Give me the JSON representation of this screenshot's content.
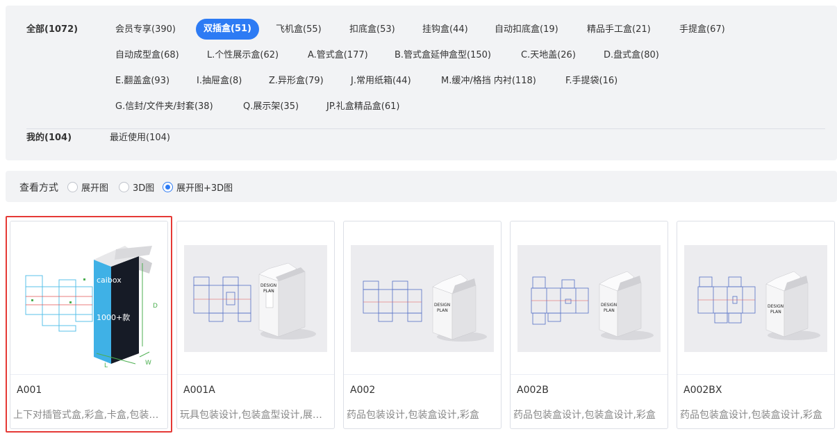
{
  "categories": {
    "all": "全部(1072)",
    "rows": [
      [
        "会员专享(390)",
        "双插盒(51)",
        "飞机盒(55)",
        "扣底盒(53)",
        "挂钩盒(44)",
        "自动扣底盒(19)",
        "精品手工盒(21)",
        "手提盒(67)"
      ],
      [
        "自动成型盒(68)",
        "L.个性展示盒(62)",
        "A.管式盒(177)",
        "B.管式盒延伸盒型(150)",
        "C.天地盖(26)",
        "D.盘式盒(80)"
      ],
      [
        "E.翻盖盒(93)",
        "I.抽屉盒(8)",
        "Z.异形盒(79)",
        "J.常用纸箱(44)",
        "M.缓冲/格挡 内衬(118)",
        "F.手提袋(16)"
      ],
      [
        "G.信封/文件夹/封套(38)",
        "Q.展示架(35)",
        "JP.礼盒精品盒(61)"
      ]
    ],
    "active": "双插盒(51)",
    "mine": "我的(104)",
    "recent": "最近使用(104)"
  },
  "view_mode": {
    "label": "查看方式",
    "options": [
      "展开图",
      "3D图",
      "展开图+3D图"
    ],
    "selected": "展开图+3D图"
  },
  "cards": [
    {
      "code": "A001",
      "desc": "上下对插管式盒,彩盒,卡盒,包装盒设计",
      "selected": true,
      "brand": "caibox",
      "badge": "1000+款",
      "dims": [
        "D",
        "L",
        "W"
      ]
    },
    {
      "code": "A001A",
      "desc": "玩具包装设计,包装盒型设计,展示窗口",
      "box_text": [
        "DESIGN",
        "PLAN"
      ]
    },
    {
      "code": "A002",
      "desc": "药品包装设计,包装盒设计,彩盒",
      "box_text": [
        "DESIGN",
        "PLAN"
      ]
    },
    {
      "code": "A002B",
      "desc": "药品包装盒设计,包装盒设计,彩盒",
      "box_text": [
        "DESIGN",
        "PLAN"
      ]
    },
    {
      "code": "A002BX",
      "desc": "药品包装盒设计,包装盒设计,彩盒",
      "box_text": [
        "DESIGN",
        "PLAN"
      ]
    }
  ],
  "colors": {
    "accent": "#2d7bf4",
    "selected_border": "#e53935",
    "box_blue": "#3fb1e6"
  }
}
